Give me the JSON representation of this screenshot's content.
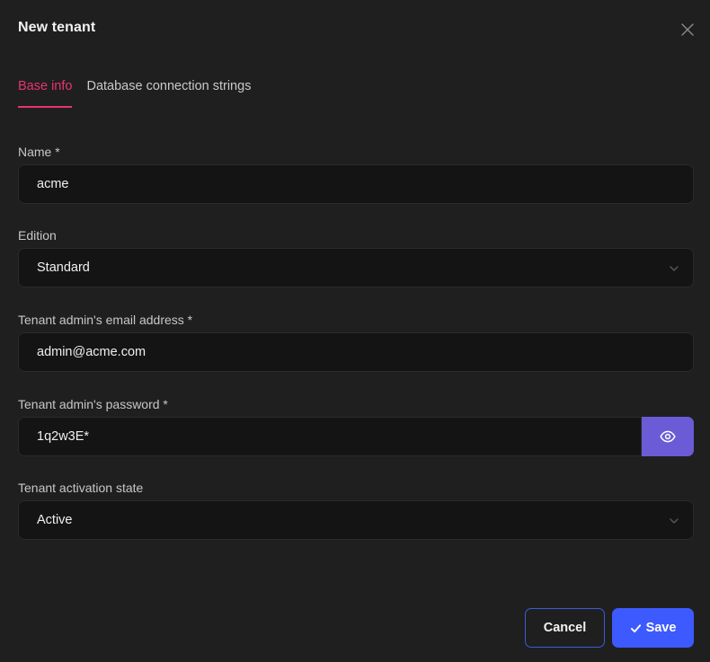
{
  "modal": {
    "title": "New tenant"
  },
  "tabs": [
    {
      "label": "Base info",
      "active": true
    },
    {
      "label": "Database connection strings",
      "active": false
    }
  ],
  "form": {
    "name": {
      "label": "Name *",
      "value": "acme"
    },
    "edition": {
      "label": "Edition",
      "value": "Standard"
    },
    "email": {
      "label": "Tenant admin's email address *",
      "value": "admin@acme.com"
    },
    "password": {
      "label": "Tenant admin's password *",
      "value": "1q2w3E*"
    },
    "activation": {
      "label": "Tenant activation state",
      "value": "Active"
    }
  },
  "actions": {
    "cancel_label": "Cancel",
    "save_label": "Save"
  },
  "icons": {
    "close": "close-icon",
    "chevron": "chevron-down-icon",
    "eye": "eye-icon",
    "check": "check-icon"
  },
  "colors": {
    "background": "#1f1f1f",
    "input_bg": "#141414",
    "active_tab": "#e8336f",
    "eye_button": "#6c5bd6",
    "primary": "#3d5afe"
  }
}
